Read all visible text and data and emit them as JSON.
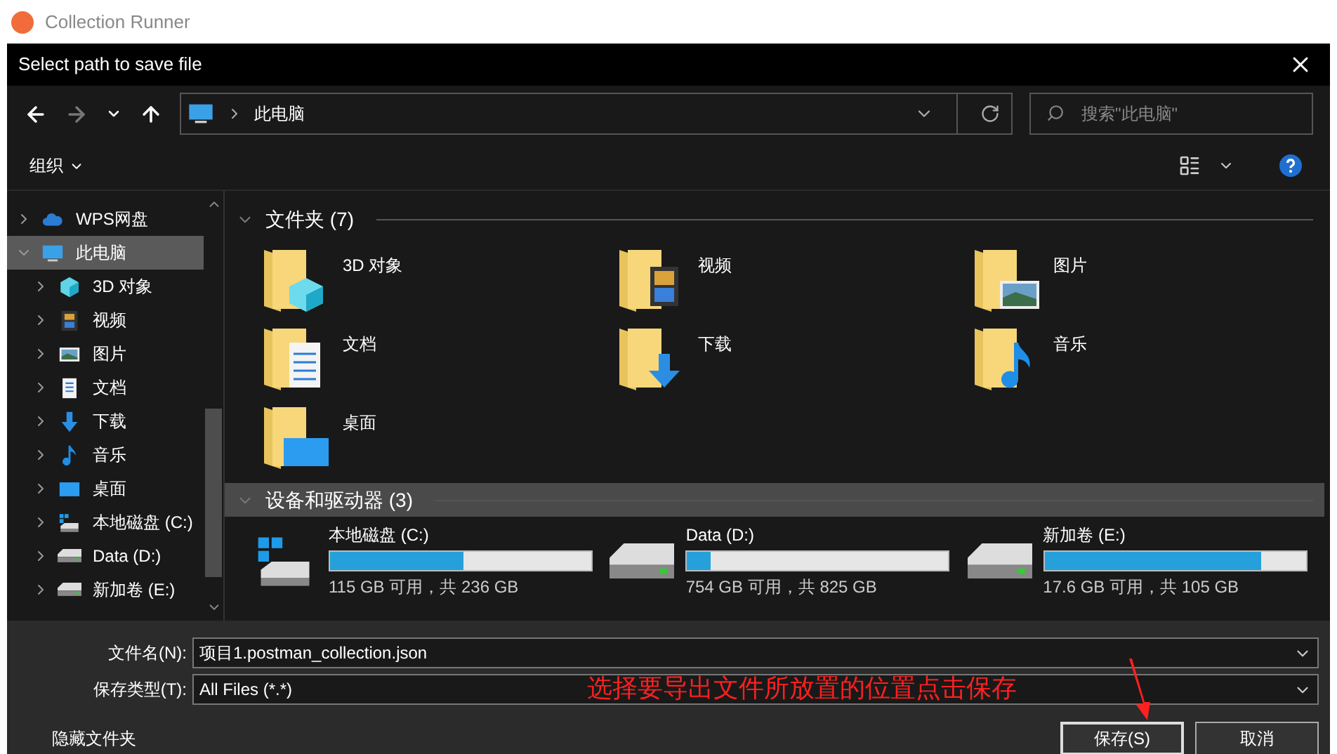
{
  "app": {
    "title": "Collection Runner"
  },
  "dialog": {
    "title": "Select path to save file"
  },
  "nav_buttons": [
    {
      "kind": "back",
      "disabled": false
    },
    {
      "kind": "forward",
      "disabled": true
    },
    {
      "kind": "recent",
      "disabled": false
    },
    {
      "kind": "up",
      "disabled": false
    }
  ],
  "address": {
    "crumbs": [
      "此电脑"
    ]
  },
  "search": {
    "placeholder": "搜索\"此电脑\""
  },
  "toolbar": {
    "organize": "组织"
  },
  "sidebar": {
    "items": [
      {
        "label": "WPS网盘",
        "kind": "cloud",
        "expanded": false,
        "selected": false
      },
      {
        "label": "此电脑",
        "kind": "pc",
        "expanded": true,
        "selected": true,
        "children": [
          {
            "label": "3D 对象",
            "kind": "cube",
            "expanded": false,
            "selected": false
          },
          {
            "label": "视频",
            "kind": "video",
            "expanded": false,
            "selected": false
          },
          {
            "label": "图片",
            "kind": "picture",
            "expanded": false,
            "selected": false
          },
          {
            "label": "文档",
            "kind": "document",
            "expanded": false,
            "selected": false
          },
          {
            "label": "下载",
            "kind": "download",
            "expanded": false,
            "selected": false
          },
          {
            "label": "音乐",
            "kind": "music",
            "expanded": false,
            "selected": false
          },
          {
            "label": "桌面",
            "kind": "desktop",
            "expanded": false,
            "selected": false
          },
          {
            "label": "本地磁盘 (C:)",
            "kind": "sysdrive",
            "expanded": false,
            "selected": false
          },
          {
            "label": "Data (D:)",
            "kind": "drive",
            "expanded": false,
            "selected": false
          },
          {
            "label": "新加卷 (E:)",
            "kind": "drive",
            "expanded": false,
            "selected": false
          }
        ]
      }
    ]
  },
  "folders": {
    "heading": "文件夹 (7)",
    "expanded": true,
    "items": [
      {
        "label": "3D 对象",
        "kind": "cube"
      },
      {
        "label": "视频",
        "kind": "video"
      },
      {
        "label": "图片",
        "kind": "picture"
      },
      {
        "label": "文档",
        "kind": "document"
      },
      {
        "label": "下载",
        "kind": "download"
      },
      {
        "label": "音乐",
        "kind": "music"
      },
      {
        "label": "桌面",
        "kind": "desktop"
      }
    ]
  },
  "drives": {
    "heading": "设备和驱动器 (3)",
    "expanded": true,
    "items": [
      {
        "label": "本地磁盘 (C:)",
        "kind": "sysdrive",
        "level": 0.51,
        "usage": "115 GB 可用，共 236 GB"
      },
      {
        "label": "Data (D:)",
        "kind": "drive",
        "level": 0.09,
        "usage": "754 GB 可用，共 825 GB"
      },
      {
        "label": "新加卷 (E:)",
        "kind": "drive",
        "level": 0.83,
        "usage": "17.6 GB 可用，共 105 GB"
      }
    ]
  },
  "file_name": {
    "label": "文件名(N):",
    "value": "项目1.postman_collection.json"
  },
  "file_type": {
    "label": "保存类型(T):",
    "value": "All Files (*.*)"
  },
  "annotation": "选择要导出文件所放置的位置点击保存",
  "hide_folders": "隐藏文件夹",
  "buttons": [
    {
      "label": "保存(S)",
      "kind": "primary"
    },
    {
      "label": "取消",
      "kind": "cancel"
    }
  ]
}
